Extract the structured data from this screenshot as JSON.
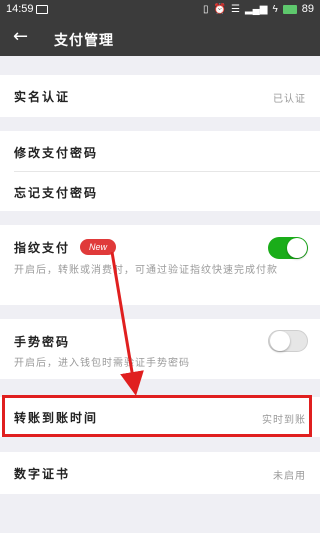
{
  "status_bar": {
    "time": "14:59",
    "battery": "89"
  },
  "header": {
    "title": "支付管理",
    "back_icon": "arrow-left-icon"
  },
  "real_name": {
    "label": "实名认证",
    "value": "已认证"
  },
  "change_password": {
    "label": "修改支付密码"
  },
  "forgot_password": {
    "label": "忘记支付密码"
  },
  "fingerprint": {
    "label": "指纹支付",
    "badge": "New",
    "desc": "开启后，转账或消费时，可通过验证指纹快速完成付款",
    "enabled": true
  },
  "gesture": {
    "label": "手势密码",
    "desc": "开启后，进入钱包时需验证手势密码",
    "enabled": false
  },
  "transfer_time": {
    "label": "转账到账时间",
    "value": "实时到账"
  },
  "certificate": {
    "label": "数字证书",
    "value": "未启用"
  },
  "colors": {
    "header": "#3b3b3b",
    "toggle_on": "#1aad19",
    "annotation": "#e01f1f"
  }
}
